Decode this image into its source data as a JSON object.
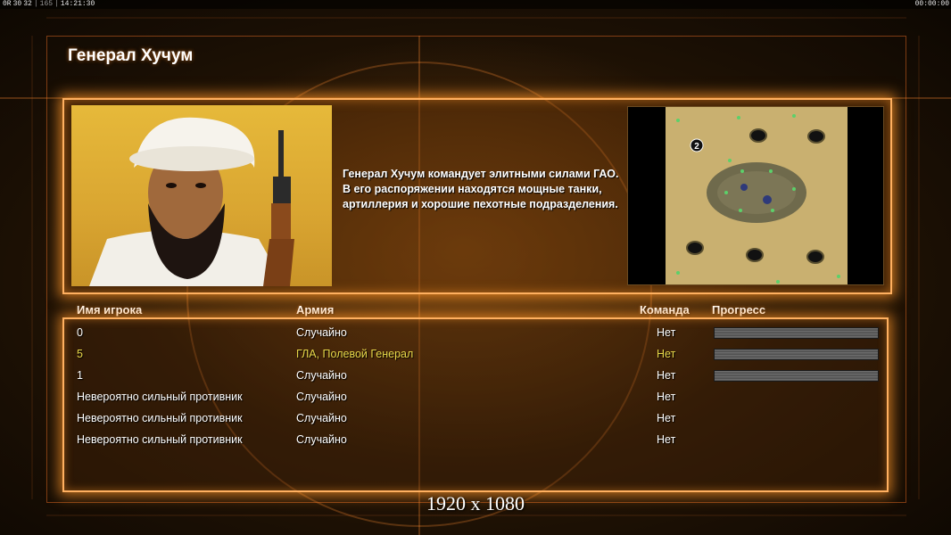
{
  "status_bar": {
    "fields": [
      "0R",
      "30",
      "32",
      "165",
      "14:21:30"
    ],
    "clock_right": "00:00:00"
  },
  "screen_title": "Генерал Хучум",
  "general": {
    "description": "Генерал Хучум командует элитными силами ГАО. В его распоряжении находятся мощные танки, артиллерия и хорошие пехотные подразделения."
  },
  "minimap": {
    "start_marker": "2"
  },
  "players_table": {
    "headers": {
      "name": "Имя игрока",
      "army": "Армия",
      "team": "Команда",
      "progress": "Прогресс"
    },
    "rows": [
      {
        "name": "0",
        "army": "Случайно",
        "team": "Нет",
        "progress": 1.0,
        "highlighted": false
      },
      {
        "name": "5",
        "army": "ГЛА, Полевой Генерал",
        "team": "Нет",
        "progress": 1.0,
        "highlighted": true
      },
      {
        "name": "1",
        "army": "Случайно",
        "team": "Нет",
        "progress": 1.0,
        "highlighted": false
      },
      {
        "name": "Невероятно сильный противник",
        "army": "Случайно",
        "team": "Нет",
        "progress": null,
        "highlighted": false
      },
      {
        "name": "Невероятно сильный противник",
        "army": "Случайно",
        "team": "Нет",
        "progress": null,
        "highlighted": false
      },
      {
        "name": "Невероятно сильный противник",
        "army": "Случайно",
        "team": "Нет",
        "progress": null,
        "highlighted": false
      }
    ]
  },
  "resolution_caption": "1920 x 1080",
  "colors": {
    "accent_orange": "#ffb060",
    "highlight_yellow": "#e8d84a",
    "text_white": "#ffffff"
  }
}
